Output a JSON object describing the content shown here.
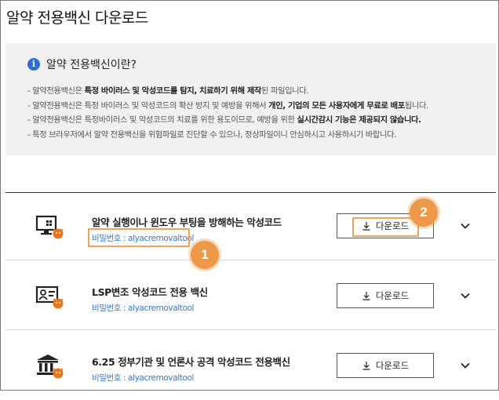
{
  "page_title": "알약 전용백신 다운로드",
  "info": {
    "title": "알약 전용백신이란?",
    "icon": "info-icon",
    "lines": [
      {
        "prefix": "-  알약전용백신은 ",
        "bold": "특정 바이러스 및 악성코드를 탐지, 치료하기 위해 제작",
        "suffix": "된 파일입니다."
      },
      {
        "prefix": "-  알약전용백신은 특정 바이러스 및 악성코드의 확산 방지 및 예방을 위해서 ",
        "bold": "개인, 기업의 모든 사용자에게 무료로 배포",
        "suffix": "됩니다."
      },
      {
        "prefix": "-  알약전용백신은 특정바이러스 및 악성코드의 치료를 위한 용도이므로, 예방을 위한 ",
        "bold": "실시간감시 기능은 제공되지 않습니다.",
        "suffix": ""
      },
      {
        "prefix": "-  특정 브라우저에서 알약 전용백신을 위험파일로 진단할 수 있으나, 정상파일이니 안심하시고 사용하시기 바랍니다.",
        "bold": "",
        "suffix": ""
      }
    ]
  },
  "rows": [
    {
      "title": "알약 실행이나 윈도우 부팅을 방해하는 악성코드",
      "password": "비밀번호 : alyacremovaltool",
      "download_label": "다운로드",
      "icon": "monitor-malware-icon"
    },
    {
      "title": "LSP변조 악성코드 전용 백신",
      "password": "비밀번호 : alyacremovaltool",
      "download_label": "다운로드",
      "icon": "id-card-malware-icon"
    },
    {
      "title": "6.25 정부기관 및 언론사 공격 악성코드 전용백신",
      "password": "비밀번호 : alyacremovaltool",
      "download_label": "다운로드",
      "icon": "government-building-malware-icon"
    }
  ],
  "annotations": {
    "badge_1": "1",
    "badge_2": "2",
    "highlight_color": "#f0a35c"
  }
}
